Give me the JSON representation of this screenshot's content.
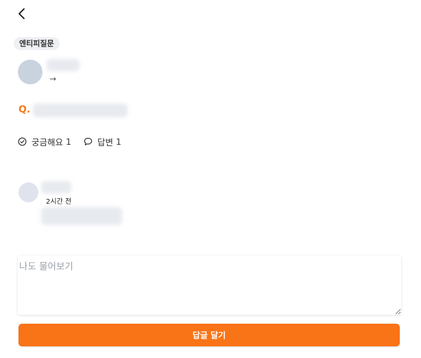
{
  "header": {
    "back_icon": "chevron-left-icon"
  },
  "question": {
    "category_tag": "엔티피질문",
    "author_link_icon": "→",
    "q_prefix": "Q."
  },
  "stats": {
    "curious_label": "궁금해요",
    "curious_count": "1",
    "curious_icon": "check-circle-icon",
    "answers_label": "답변",
    "answers_count": "1",
    "answers_icon": "speech-bubble-icon"
  },
  "comment": {
    "time": "2시간 전"
  },
  "ask": {
    "placeholder": "나도 물어보기",
    "value": ""
  },
  "submit": {
    "label": "답글 달기"
  },
  "colors": {
    "accent": "#f97317",
    "q_mark": "#f47b20"
  }
}
